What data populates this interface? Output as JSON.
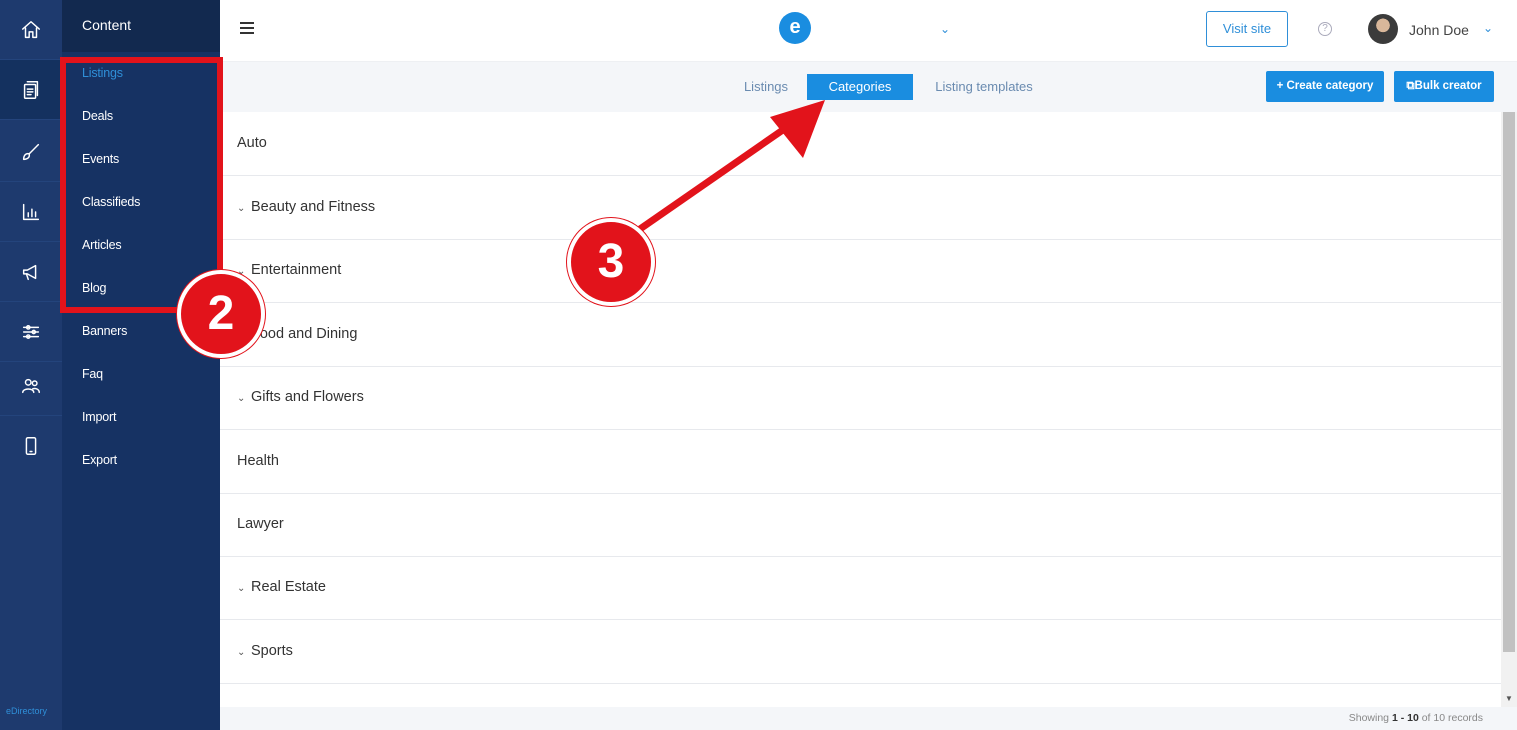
{
  "rail": {
    "items": [
      {
        "icon": "home-icon"
      },
      {
        "icon": "content-icon",
        "active": true
      },
      {
        "icon": "brush-icon"
      },
      {
        "icon": "chart-icon"
      },
      {
        "icon": "megaphone-icon"
      },
      {
        "icon": "sliders-icon"
      },
      {
        "icon": "users-icon"
      },
      {
        "icon": "mobile-icon"
      }
    ],
    "footer": "eDirectory"
  },
  "submenu": {
    "title": "Content",
    "items": [
      "Listings",
      "Deals",
      "Events",
      "Classifieds",
      "Articles",
      "Blog",
      "Banners",
      "Faq",
      "Import",
      "Export"
    ],
    "active": "Listings"
  },
  "topbar": {
    "logo_letter": "e",
    "visit_site": "Visit site",
    "help": "?",
    "user_name": "John Doe"
  },
  "tabs": {
    "items": [
      "Listings",
      "Categories",
      "Listing templates"
    ],
    "active": "Categories",
    "create_category": "+ Create category",
    "bulk_creator": "Bulk creator"
  },
  "categories": [
    {
      "name": "Auto",
      "expandable": false
    },
    {
      "name": "Beauty and Fitness",
      "expandable": true
    },
    {
      "name": "Entertainment",
      "expandable": true
    },
    {
      "name": "Food and Dining",
      "expandable": true
    },
    {
      "name": "Gifts and Flowers",
      "expandable": true
    },
    {
      "name": "Health",
      "expandable": false
    },
    {
      "name": "Lawyer",
      "expandable": false
    },
    {
      "name": "Real Estate",
      "expandable": true
    },
    {
      "name": "Sports",
      "expandable": true
    }
  ],
  "footer": {
    "prefix": "Showing ",
    "range": "1 - 10",
    "suffix": " of 10 records"
  },
  "annotations": {
    "badge_2": "2",
    "badge_3": "3",
    "color": "#e2131b"
  }
}
